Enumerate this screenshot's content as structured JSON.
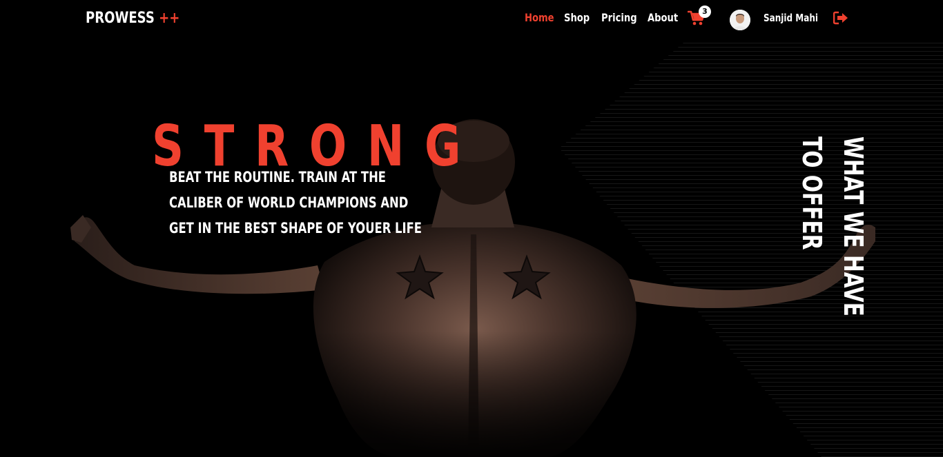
{
  "nav": {
    "logo_text": "PROWESS",
    "logo_suffix": "++",
    "links": [
      {
        "label": "Home",
        "active": true
      },
      {
        "label": "Shop",
        "active": false
      },
      {
        "label": "Pricing",
        "active": false
      },
      {
        "label": "About",
        "active": false
      }
    ],
    "cart_count": "3",
    "cart_icon": "shopping-cart-icon",
    "user_name": "Sanjid Mahi",
    "logout_icon": "sign-out-icon"
  },
  "hero": {
    "headline": "STRONG",
    "tagline_lines": [
      "BEAT THE ROUTINE. TRAIN AT THE",
      "CALIBER OF WORLD CHAMPIONS AND",
      "GET IN THE BEST SHAPE OF YOUER LIFE"
    ],
    "side_title_line1": "WHAT WE HAVE",
    "side_title_line2": "TO OFFER"
  },
  "colors": {
    "accent": "#f0412f",
    "background": "#000000",
    "text": "#ffffff"
  }
}
